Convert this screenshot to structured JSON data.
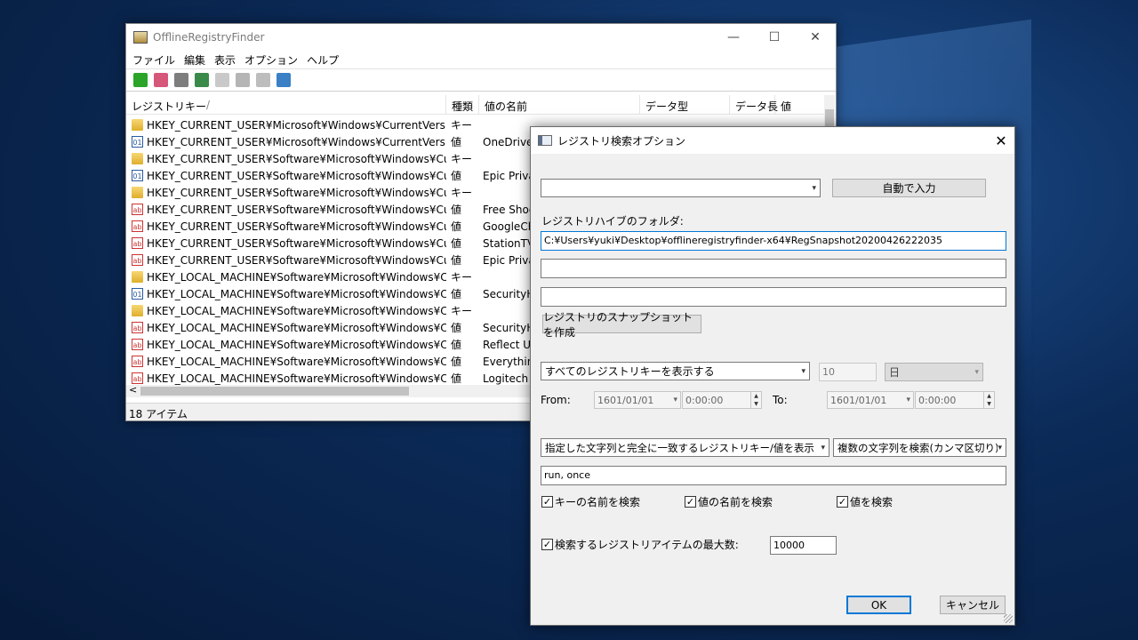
{
  "main_window": {
    "title": "OfflineRegistryFinder",
    "caption": {
      "minimize": "—",
      "maximize": "☐",
      "close": "✕"
    },
    "menu": [
      "ファイル",
      "編集",
      "表示",
      "オプション",
      "ヘルプ"
    ],
    "columns": [
      "レジストリキー",
      "/",
      "種類",
      "値の名前",
      "データ型",
      "データ長",
      "値"
    ],
    "rows": [
      {
        "key": "HKEY_CURRENT_USER¥Microsoft¥Windows¥CurrentVersion¥E...",
        "type": "キー",
        "value_name": "",
        "icon": "folder"
      },
      {
        "key": "HKEY_CURRENT_USER¥Microsoft¥Windows¥CurrentVersion¥E...",
        "type": "値",
        "value_name": "OneDriveS",
        "icon": "bin"
      },
      {
        "key": "HKEY_CURRENT_USER¥Software¥Microsoft¥Windows¥Current...",
        "type": "キー",
        "value_name": "",
        "icon": "folder"
      },
      {
        "key": "HKEY_CURRENT_USER¥Software¥Microsoft¥Windows¥Current...",
        "type": "値",
        "value_name": "Epic Privac",
        "icon": "bin"
      },
      {
        "key": "HKEY_CURRENT_USER¥Software¥Microsoft¥Windows¥Current...",
        "type": "キー",
        "value_name": "",
        "icon": "folder"
      },
      {
        "key": "HKEY_CURRENT_USER¥Software¥Microsoft¥Windows¥Current...",
        "type": "値",
        "value_name": "Free Shoot",
        "icon": "str"
      },
      {
        "key": "HKEY_CURRENT_USER¥Software¥Microsoft¥Windows¥Current...",
        "type": "値",
        "value_name": "GoogleCh",
        "icon": "str"
      },
      {
        "key": "HKEY_CURRENT_USER¥Software¥Microsoft¥Windows¥Current...",
        "type": "値",
        "value_name": "StationTV_",
        "icon": "str"
      },
      {
        "key": "HKEY_CURRENT_USER¥Software¥Microsoft¥Windows¥Current...",
        "type": "値",
        "value_name": "Epic Privac",
        "icon": "str"
      },
      {
        "key": "HKEY_LOCAL_MACHINE¥Software¥Microsoft¥Windows¥Curre...",
        "type": "キー",
        "value_name": "",
        "icon": "folder"
      },
      {
        "key": "HKEY_LOCAL_MACHINE¥Software¥Microsoft¥Windows¥Curre...",
        "type": "値",
        "value_name": "SecurityH",
        "icon": "bin"
      },
      {
        "key": "HKEY_LOCAL_MACHINE¥Software¥Microsoft¥Windows¥Curre...",
        "type": "キー",
        "value_name": "",
        "icon": "folder"
      },
      {
        "key": "HKEY_LOCAL_MACHINE¥Software¥Microsoft¥Windows¥Curre...",
        "type": "値",
        "value_name": "SecurityH",
        "icon": "str"
      },
      {
        "key": "HKEY_LOCAL_MACHINE¥Software¥Microsoft¥Windows¥Curre...",
        "type": "値",
        "value_name": "Reflect UI",
        "icon": "str"
      },
      {
        "key": "HKEY_LOCAL_MACHINE¥Software¥Microsoft¥Windows¥Curre...",
        "type": "値",
        "value_name": "Everything",
        "icon": "str"
      },
      {
        "key": "HKEY_LOCAL_MACHINE¥Software¥Microsoft¥Windows¥Curre...",
        "type": "値",
        "value_name": "Logitech D",
        "icon": "str"
      }
    ],
    "status": "18 アイテム"
  },
  "dialog": {
    "title": "レジストリ検索オプション",
    "close": "✕",
    "source_combo": "",
    "auto_fill_button": "自動で入力",
    "hive_folder_label": "レジストリハイブのフォルダ:",
    "hive_folder_value": "C:¥Users¥yuki¥Desktop¥offlineregistryfinder-x64¥RegSnapshot20200426222035",
    "extra_field_1": "",
    "extra_field_2": "",
    "snapshot_button": "レジストリのスナップショットを作成",
    "time_filter_combo": "すべてのレジストリキーを表示する",
    "time_amount": "10",
    "time_unit": "日",
    "from_label": "From:",
    "from_date": "1601/01/01",
    "from_time": "0:00:00",
    "to_label": "To:",
    "to_date": "1601/01/01",
    "to_time": "0:00:00",
    "match_mode_combo": "指定した文字列と完全に一致するレジストリキー/値を表示",
    "multi_mode_combo": "複数の文字列を検索(カンマ区切り)",
    "search_text": "run, once",
    "check_key_name": "キーの名前を検索",
    "check_value_name": "値の名前を検索",
    "check_value": "値を検索",
    "check_max_items": "検索するレジストリアイテムの最大数:",
    "max_items_value": "10000",
    "ok_button": "OK",
    "cancel_button": "キャンセル",
    "check_mark": "✓"
  }
}
